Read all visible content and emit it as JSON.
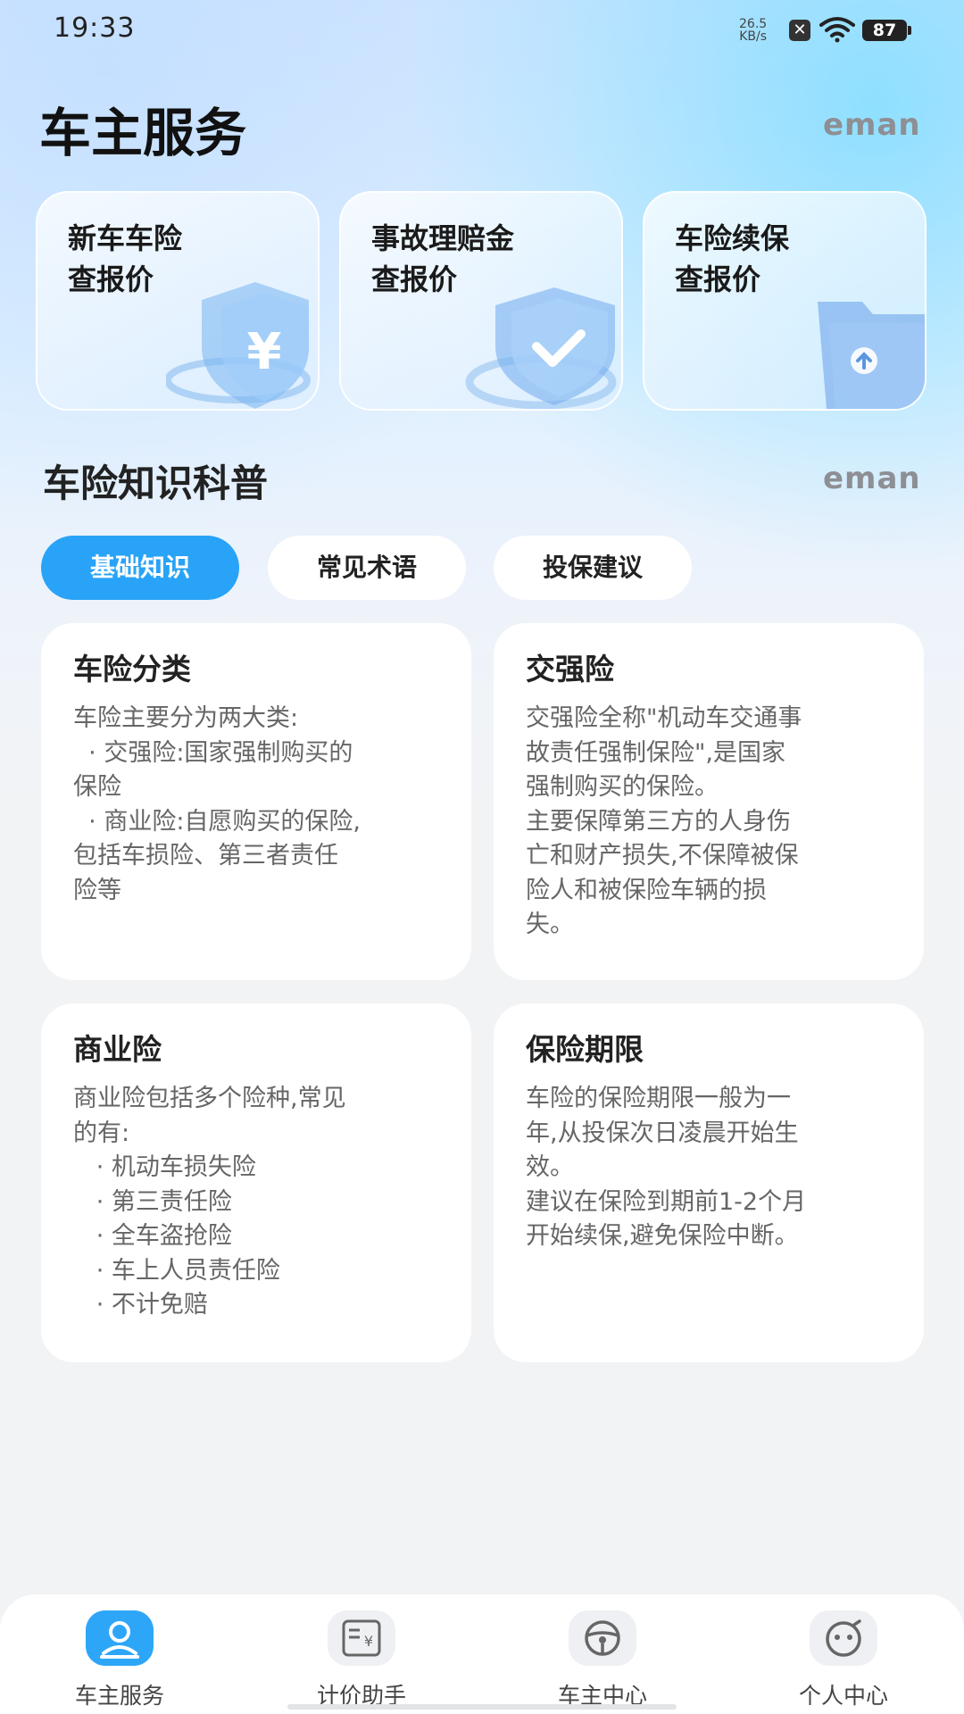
{
  "status": {
    "time": "19:33",
    "net_speed_value": "26.5",
    "net_speed_unit": "KB/s",
    "battery": "87"
  },
  "header": {
    "title": "车主服务",
    "brand": "eman"
  },
  "quick_actions": [
    {
      "label": "新车车险\n查报价",
      "icon": "shield-yen-icon"
    },
    {
      "label": "事故理赔金\n查报价",
      "icon": "shield-check-icon"
    },
    {
      "label": "车险续保\n查报价",
      "icon": "folder-upload-icon"
    }
  ],
  "section": {
    "title": "车险知识科普",
    "brand": "eman"
  },
  "tabs": [
    {
      "label": "基础知识",
      "active": true
    },
    {
      "label": "常见术语",
      "active": false
    },
    {
      "label": "投保建议",
      "active": false
    }
  ],
  "cards": [
    {
      "title": "车险分类",
      "body": "车险主要分为两大类:\n  · 交强险:国家强制购买的\n保险\n  · 商业险:自愿购买的保险,\n包括车损险、第三者责任\n险等"
    },
    {
      "title": "交强险",
      "body": "交强险全称\"机动车交通事\n故责任强制保险\",是国家\n强制购买的保险。\n主要保障第三方的人身伤\n亡和财产损失,不保障被保\n险人和被保险车辆的损\n失。"
    },
    {
      "title": "商业险",
      "body": "商业险包括多个险种,常见\n的有:\n   · 机动车损失险\n   · 第三责任险\n   · 全车盗抢险\n   · 车上人员责任险\n   · 不计免赔"
    },
    {
      "title": "保险期限",
      "body": "车险的保险期限一般为一\n年,从投保次日凌晨开始生\n效。\n建议在保险到期前1-2个月\n开始续保,避免保险中断。"
    }
  ],
  "bottom_nav": [
    {
      "label": "车主服务",
      "icon": "user-icon",
      "active": true
    },
    {
      "label": "计价助手",
      "icon": "receipt-icon",
      "active": false
    },
    {
      "label": "车主中心",
      "icon": "steering-wheel-icon",
      "active": false
    },
    {
      "label": "个人中心",
      "icon": "smiley-icon",
      "active": false
    }
  ],
  "colors": {
    "accent": "#29a3f7",
    "background": "#f2f3f5",
    "brand_gray": "#8d8f94"
  }
}
